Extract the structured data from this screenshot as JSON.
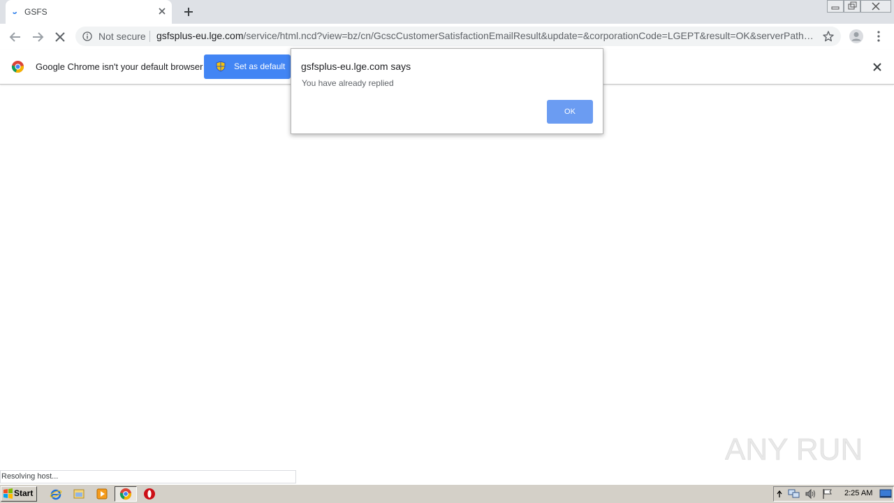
{
  "browser": {
    "tab": {
      "title": "GSFS"
    },
    "omnibox": {
      "security_label": "Not secure",
      "url_host": "gsfsplus-eu.lge.com",
      "url_path": "/service/html.ncd?view=bz/cn/GcscCustomerSatisfactionEmailResult&update=&corporationCode=LGEPT&result=OK&serverPath=ht..."
    },
    "infobar": {
      "message": "Google Chrome isn't your default browser",
      "button_label": "Set as default"
    },
    "status_text": "Resolving host..."
  },
  "dialog": {
    "title": "gsfsplus-eu.lge.com says",
    "message": "You have already replied",
    "ok_label": "OK"
  },
  "taskbar": {
    "start_label": "Start",
    "clock": "2:25 AM"
  },
  "watermark": {
    "text": "ANY RUN"
  },
  "colors": {
    "accent_blue": "#4285f4",
    "dialog_button": "#6b9cf2",
    "tab_strip": "#dee1e6",
    "taskbar": "#d4d0c8"
  },
  "icons": [
    "loading-spinner-icon",
    "close-icon",
    "plus-icon",
    "back-arrow-icon",
    "forward-arrow-icon",
    "stop-icon",
    "info-icon",
    "star-icon",
    "avatar-icon",
    "menu-icon",
    "chrome-logo-icon",
    "shield-icon",
    "windows-logo-icon",
    "ie-icon",
    "folder-icon",
    "media-player-icon",
    "chrome-icon",
    "opera-icon",
    "chevron-up-icon",
    "network-icon",
    "volume-icon",
    "flag-icon",
    "desktop-icon"
  ]
}
